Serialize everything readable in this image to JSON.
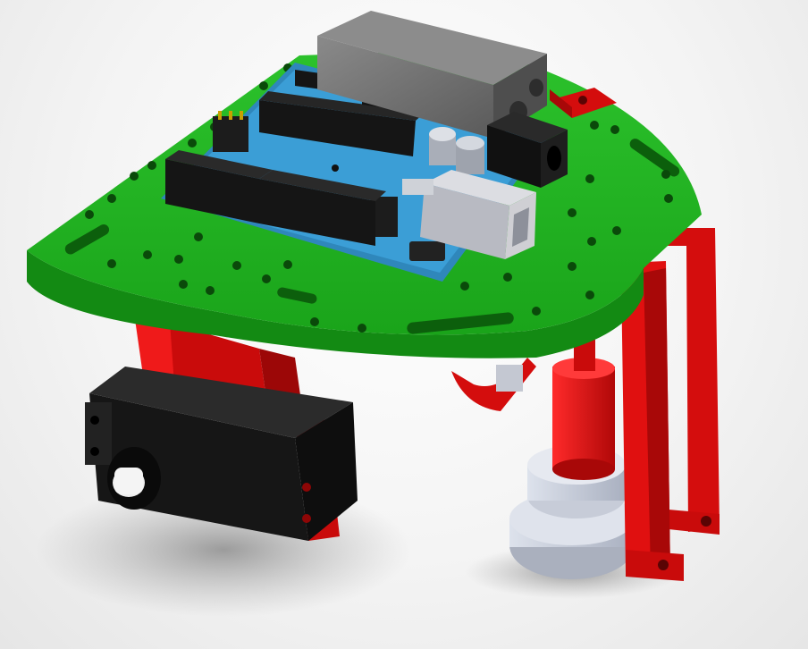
{
  "scene": {
    "subject": "robot-chassis-render",
    "colors": {
      "chassis_plate": "#1fae1f",
      "chassis_plate_edge": "#138a13",
      "brackets": "#d40d0d",
      "bracket_dark": "#8e0606",
      "microcontroller_board": "#3b9ed6",
      "headers": "#1c1c1c",
      "battery": "#6e6e6e",
      "usb_connector": "#cfcfd4",
      "servo_body": "#1b1b1b",
      "wheel_hub": "#c7ccd8",
      "shadow": "#9a9a9a"
    },
    "components": [
      "chassis-plate",
      "microcontroller-board",
      "battery-pack",
      "dc-power-jack",
      "usb-b-connector",
      "pin-headers",
      "capacitors",
      "servo-motor",
      "servo-mount-bracket",
      "caster-wheel",
      "sensor-mount-bracket"
    ]
  }
}
